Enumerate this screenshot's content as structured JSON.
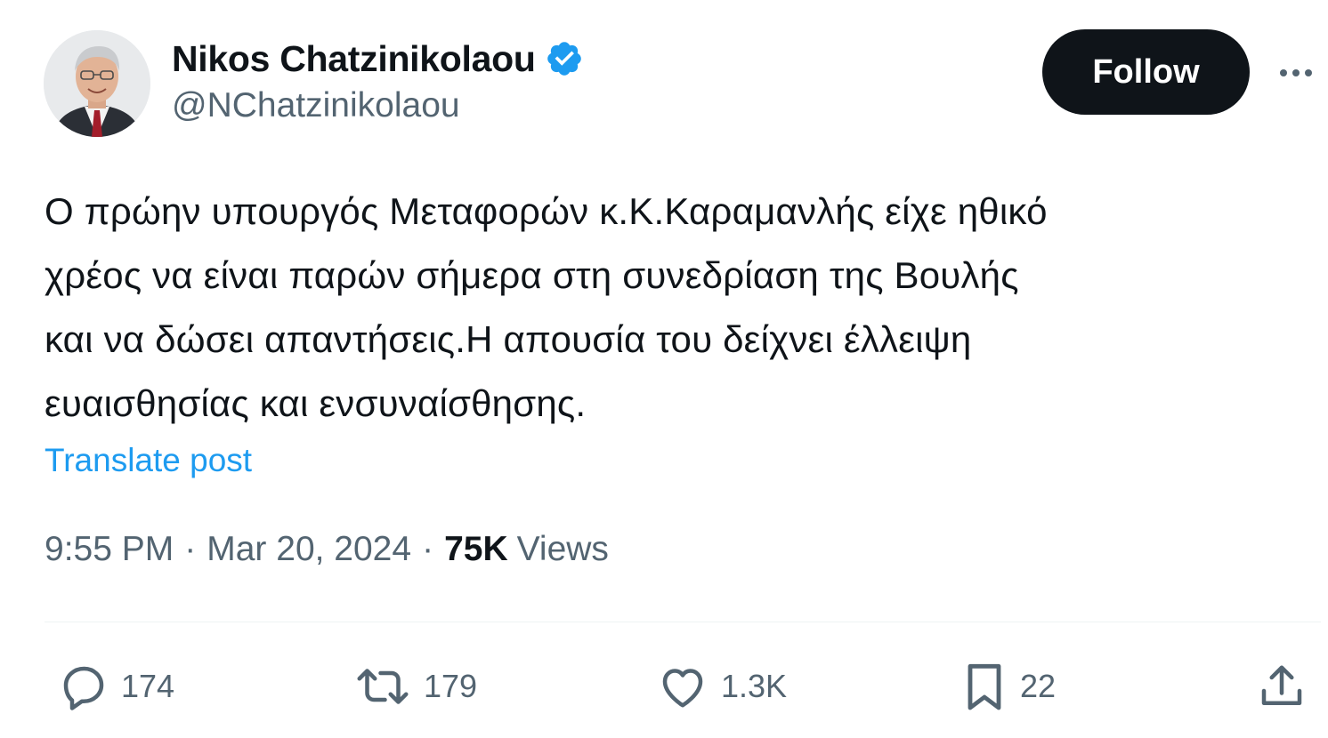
{
  "author": {
    "display_name": "Nikos Chatzinikolaou",
    "handle": "@NChatzinikolaou",
    "verified": true,
    "avatar_icon": "profile-photo-avatar"
  },
  "header": {
    "follow_label": "Follow",
    "more_icon": "more-horizontal-icon"
  },
  "post": {
    "text": "Ο πρώην υπουργός Μεταφορών κ.Κ.Καραμανλής είχε ηθικό\nχρέος να είναι παρών σήμερα στη συνεδρίαση της Βουλής\nκαι να δώσει απαντήσεις.Η απουσία του δείχνει έλλειψη\nευαισθησίας και ενσυναίσθησης.",
    "translate_label": "Translate post"
  },
  "meta": {
    "time": "9:55 PM",
    "separator": "·",
    "date": "Mar 20, 2024",
    "views_count": "75K",
    "views_label": "Views"
  },
  "actions": {
    "replies": "174",
    "reposts": "179",
    "likes": "1.3K",
    "bookmarks": "22"
  },
  "colors": {
    "text": "#0f1419",
    "secondary": "#536471",
    "accent": "#1d9bf0",
    "follow_bg": "#0f1419"
  }
}
